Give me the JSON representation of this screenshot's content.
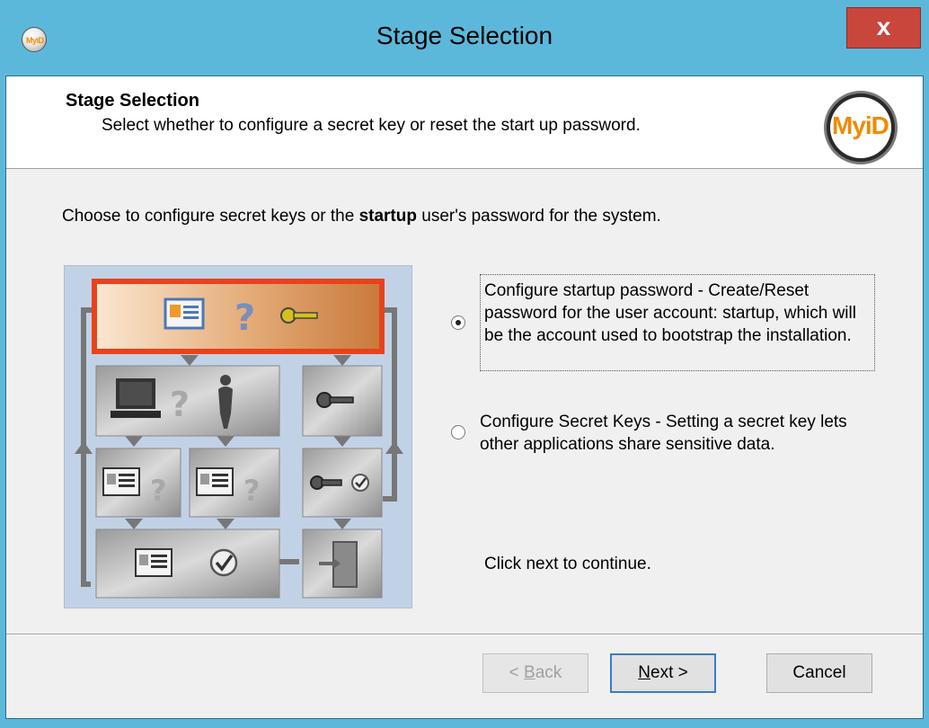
{
  "window": {
    "title": "Stage Selection",
    "app_icon_text": "MyiD",
    "close_label": "x"
  },
  "header": {
    "title": "Stage Selection",
    "subtitle": "Select whether to configure a secret key or reset the start up password.",
    "logo_text": "MyiD"
  },
  "body": {
    "instruction_before": "Choose to configure secret keys or the ",
    "instruction_bold": "startup",
    "instruction_after": " user's password for the system."
  },
  "options": [
    {
      "label": "Configure startup password - Create/Reset password for the user account: startup, which will be the account used to bootstrap the installation.",
      "selected": true
    },
    {
      "label": "Configure Secret Keys - Setting a secret key lets other applications share sensitive data.",
      "selected": false
    }
  ],
  "continue_text": "Click next to continue.",
  "buttons": {
    "back_prefix": "< ",
    "back_mnemonic": "B",
    "back_rest": "ack",
    "next_mnemonic": "N",
    "next_rest": "ext >",
    "cancel": "Cancel"
  },
  "colors": {
    "titlebar": "#5cb8da",
    "close": "#c9463d",
    "diagram_bg": "#c2d2e6",
    "highlight_border": "#e8421c",
    "highlight_fill": "#d8955a"
  }
}
